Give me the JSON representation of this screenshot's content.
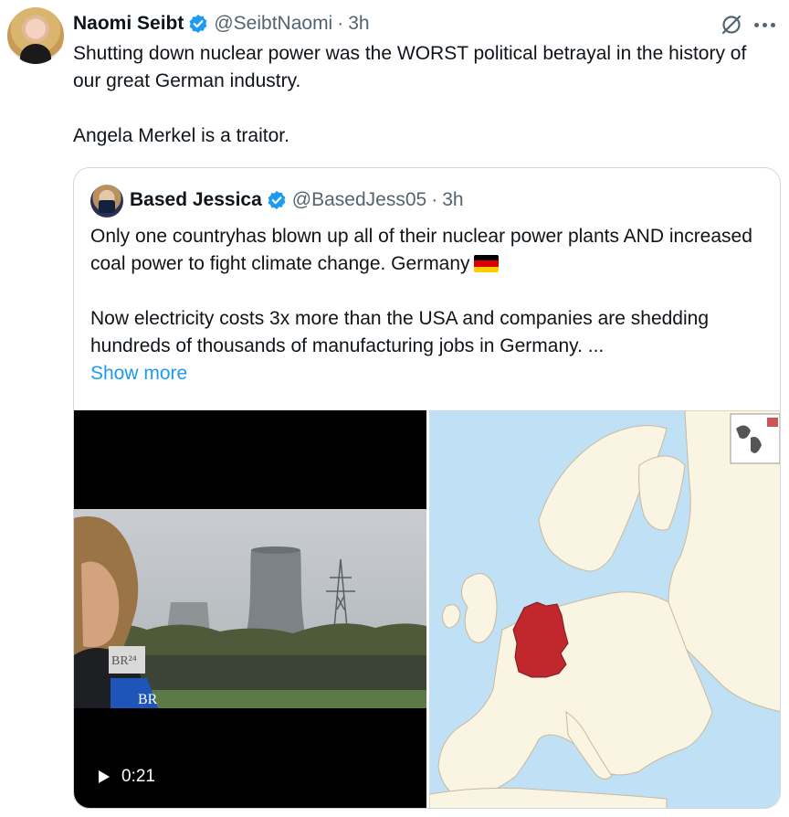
{
  "tweet": {
    "author_name": "Naomi Seibt",
    "author_handle": "@SeibtNaomi",
    "separator": "·",
    "time": "3h",
    "paragraphs": [
      "Shutting down nuclear power was the WORST political betrayal in the history of our great German industry.",
      "Angela Merkel is a traitor."
    ]
  },
  "quote": {
    "author_name": "Based Jessica",
    "author_handle": "@BasedJess05",
    "separator": "·",
    "time": "3h",
    "paragraph1": "Only one countryhas blown up all of their nuclear power plants AND increased coal power to fight climate change. Germany",
    "paragraph2": "Now electricity costs 3x more than the USA and companies are shedding hundreds of thousands of manufacturing jobs in Germany. ...",
    "show_more": "Show more",
    "flag_colors": [
      "#000000",
      "#dd0000",
      "#ffce00"
    ],
    "video": {
      "duration": "0:21",
      "logo_text": "BR",
      "logo_superscript": "24",
      "mic_text": "BR"
    }
  },
  "colors": {
    "verified_blue": "#1d9bf0",
    "link_blue": "#1d9bf0",
    "secondary_text": "#536471",
    "germany_highlight": "#c0282d",
    "land": "#faf4e3",
    "sea": "#bfe0f5"
  }
}
